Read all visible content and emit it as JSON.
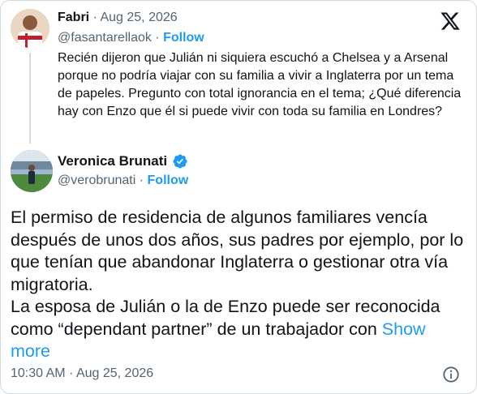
{
  "parent": {
    "name": "Fabri",
    "separator": "·",
    "date": "Aug 25, 2026",
    "handle": "@fasantarellaok",
    "follow": "Follow",
    "text": "Recién dijeron que Julián ni siquiera escuchó a Chelsea y a Arsenal porque no podría viajar con su familia a vivir a Inglaterra por un tema de papeles. Pregunto con total ignorancia en el tema; ¿Qué diferencia hay con Enzo que él si puede vivir con toda su familia en Londres?"
  },
  "quote": {
    "name": "Veronica Brunati",
    "handle": "@verobrunati",
    "separator": "·",
    "follow": "Follow",
    "text": "El permiso de residencia de algunos familiares vencía después de unos dos años, sus padres por ejemplo, por lo que tenían que abandonar Inglaterra o gestionar otra vía migratoria.\nLa esposa de Julián o la de Enzo puede ser reconocida como “dependant partner” de un trabajador con ",
    "show_more": "Show more",
    "verified_icon": "verified-badge-icon"
  },
  "footer": {
    "time": "10:30 AM",
    "separator": "·",
    "date": "Aug 25, 2026"
  },
  "colors": {
    "accent": "#1d9bf0",
    "muted": "#536471",
    "text": "#0f1419",
    "border": "#cfd9de"
  }
}
